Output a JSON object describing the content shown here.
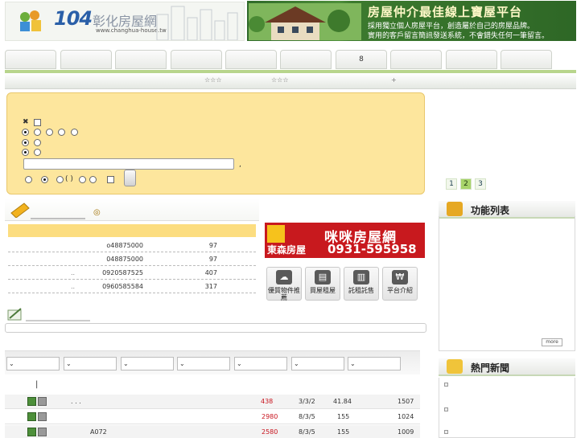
{
  "header": {
    "logo_number": "104",
    "logo_name": "彰化房屋網",
    "logo_url": "www.changhua-house.tw",
    "banner_title": "房屋仲介最佳線上寶屋平台",
    "banner_line1": "採用獨立個人房屋平台，創造屬於自己的房屋品牌。",
    "banner_line2": "實用的客戶留言簡訊發送系統，不會錯失任何一筆留言。"
  },
  "tabs": [
    "",
    "",
    "",
    "",
    "",
    "",
    "8",
    "",
    "",
    ""
  ],
  "subnav": {
    "stars_a": "☆☆☆",
    "stars_b": "☆☆☆",
    "plus": "+"
  },
  "search": {
    "close_mark": "✖",
    "punct": ",",
    "paren": "(  )",
    "keyword_value": ""
  },
  "pagination": [
    "1",
    "2",
    "3"
  ],
  "pagination_current": "2",
  "listings": {
    "header_mark": "◎",
    "rows": [
      {
        "dot": "",
        "phone": "o48875000",
        "count": "97"
      },
      {
        "dot": "",
        "phone": "048875000",
        "count": "97"
      },
      {
        "dot": "..",
        "phone": "0920587525",
        "count": "407"
      },
      {
        "dot": "..",
        "phone": "0960585584",
        "count": "317"
      }
    ]
  },
  "ad": {
    "name": "咪咪房屋網",
    "company": "東森房屋",
    "phone": "0931-595958"
  },
  "quick_links": [
    {
      "label": "優質物件推薦",
      "icon": "cloud-house-icon"
    },
    {
      "label": "買屋租屋",
      "icon": "document-icon"
    },
    {
      "label": "託租託售",
      "icon": "building-icon"
    },
    {
      "label": "平台介紹",
      "icon": "won-coin-icon"
    }
  ],
  "table": {
    "filters": [
      "",
      "",
      "",
      "",
      "",
      "",
      ""
    ],
    "sub_mark": "|",
    "rows": [
      {
        "name": ".    .    .",
        "price": "438",
        "layout": "3/3/2",
        "area": "41.84",
        "views": "1507"
      },
      {
        "name": "",
        "price": "2980",
        "layout": "8/3/5",
        "area": "155",
        "views": "1024"
      },
      {
        "name": "A072",
        "price": "2580",
        "layout": "8/3/5",
        "area": "155",
        "views": "1009"
      }
    ]
  },
  "sidebar": {
    "features_title": "功能列表",
    "more_label": "more",
    "news_title": "熱門新聞"
  },
  "colors": {
    "search_bg": "#fde69d",
    "accent_green": "#a8d46a",
    "price_red": "#c8141e",
    "ad_red": "#c8191e"
  }
}
